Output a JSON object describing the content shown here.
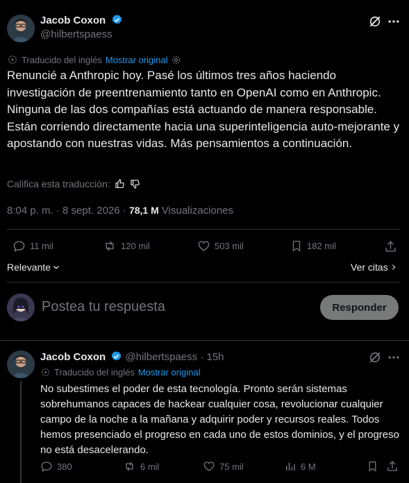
{
  "main_tweet": {
    "author_name": "Jacob Coxon",
    "author_handle": "@hilbertspaess",
    "translated_label": "Traducido del inglés",
    "show_original": "Mostrar original",
    "body": "Renuncié a Anthropic hoy. Pasé los últimos tres años haciendo investigación de preentrenamiento tanto en OpenAI como en Anthropic. Ninguna de las dos compañías está actuando de manera responsable. Están corriendo directamente hacia una superinteligencia auto-mejorante y apostando con nuestras vidas. Más pensamientos a continuación.",
    "rate_translation": "Califica esta traducción:",
    "timestamp": "8:04 p. m. · 8 sept. 2026 ·",
    "views_count": "78,1 M",
    "views_label": "Visualizaciones",
    "replies": "11 mil",
    "retweets": "120 mil",
    "likes": "503 mil",
    "bookmarks": "182 mil"
  },
  "sort": {
    "label": "Relevante",
    "quotes_link": "Ver citas"
  },
  "composer": {
    "placeholder": "Postea tu respuesta",
    "reply_button": "Responder"
  },
  "reply_tweet": {
    "author_name": "Jacob Coxon",
    "author_handle": "@hilbertspaess",
    "time": "· 15h",
    "translated_label": "Traducido del inglés",
    "show_original": "Mostrar original",
    "body": "No subestimes el poder de esta tecnología. Pronto serán sistemas sobrehumanos capaces de hackear cualquier cosa, revolucionar cualquier campo de la noche a la mañana y adquirir poder y recursos reales. Todos hemos presenciado el progreso en cada uno de estos dominios, y el progreso no está desacelerando.",
    "replies": "380",
    "retweets": "6 mil",
    "likes": "75 mil",
    "views": "6 M"
  },
  "colors": {
    "accent": "#1d9bf0",
    "muted": "#71767b",
    "text": "#e7e9ea",
    "border": "#2f3336"
  }
}
